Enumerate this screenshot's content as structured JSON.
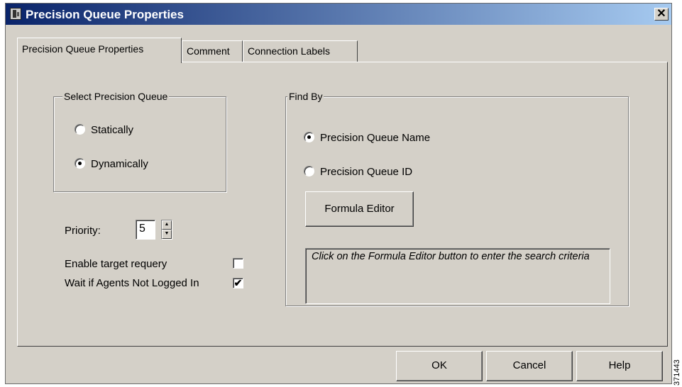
{
  "window": {
    "title": "Precision Queue Properties",
    "close_label": "✕"
  },
  "tabs": [
    {
      "label": "Precision Queue Properties",
      "active": true
    },
    {
      "label": "Comment",
      "active": false
    },
    {
      "label": "Connection Labels",
      "active": false
    }
  ],
  "select_group": {
    "label": "Select Precision Queue",
    "options": [
      {
        "label": "Statically",
        "checked": false
      },
      {
        "label": "Dynamically",
        "checked": true
      }
    ]
  },
  "priority": {
    "label": "Priority:",
    "value": "5",
    "up_glyph": "▲",
    "down_glyph": "▼"
  },
  "checks": [
    {
      "label": "Enable target requery",
      "checked": false,
      "mark": ""
    },
    {
      "label": "Wait if Agents Not Logged In",
      "checked": true,
      "mark": "✔"
    }
  ],
  "find_by": {
    "label": "Find By",
    "options": [
      {
        "label": "Precision Queue Name",
        "checked": true
      },
      {
        "label": "Precision Queue ID",
        "checked": false
      }
    ],
    "formula_button": "Formula Editor",
    "criteria_text": "Click on the Formula Editor button to enter the search criteria"
  },
  "buttons": {
    "ok": "OK",
    "cancel": "Cancel",
    "help": "Help"
  },
  "figure_id": "371443",
  "colors": {
    "dialog_bg": "#d4d0c8",
    "title_start": "#0a246a",
    "title_end": "#a6caf0"
  }
}
